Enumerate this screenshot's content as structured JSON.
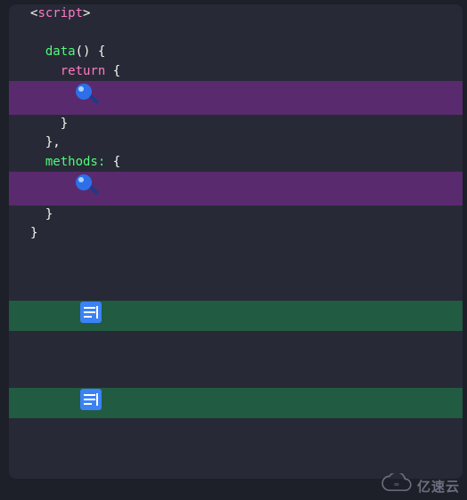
{
  "code": {
    "open_angle": "<",
    "script_tag": "script",
    "close_angle": ">",
    "data_fn": "data",
    "parens": "()",
    "brace_open": " {",
    "return_kw": "return",
    "return_brace": " {",
    "close_brace1": "}",
    "close_brace_comma": "},",
    "methods_prop": "methods:",
    "methods_brace": " {",
    "close_brace2": "}",
    "close_brace3": "}"
  },
  "icons": {
    "magnifier": "magnifier-icon",
    "document": "document-icon"
  },
  "watermark": {
    "text": "亿速云"
  },
  "colors": {
    "bg_page": "#1e2029",
    "bg_editor": "#272a36",
    "hl_purple": "#5a2a6e",
    "hl_green": "#215b42",
    "tok_tag": "#ff79c6",
    "tok_fn": "#50fa7b",
    "txt": "#f8f8f2",
    "doc_icon_bg": "#3b82f6",
    "doc_icon_fg": "#ffffff",
    "mag_lens": "#2d6fe8",
    "mag_shine": "#a8d4ff",
    "mag_handle": "#1e3a8a"
  }
}
